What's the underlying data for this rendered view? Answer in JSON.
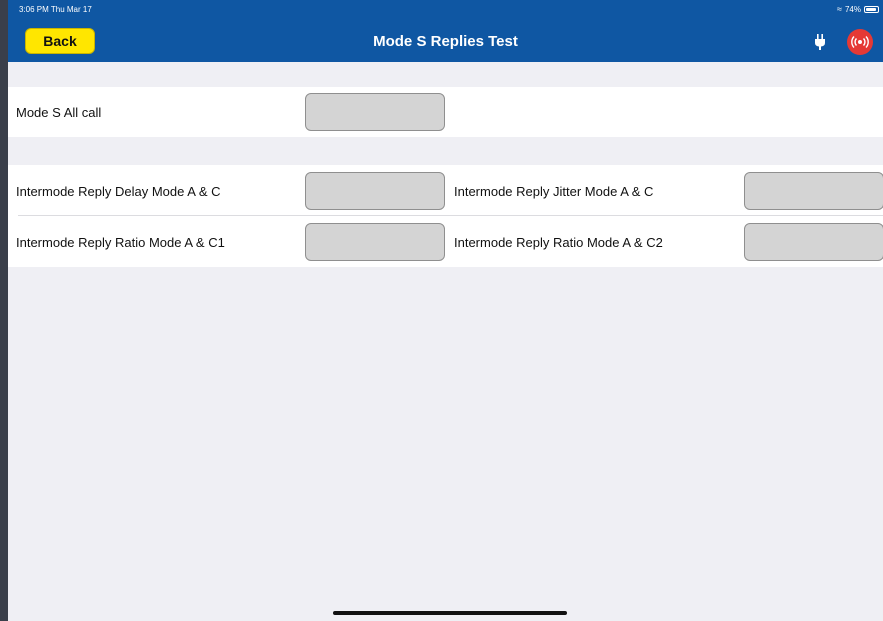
{
  "status_bar": {
    "time": "3:06 PM  Thu Mar 17",
    "battery": "74%"
  },
  "navbar": {
    "back_label": "Back",
    "title": "Mode S Replies Test",
    "brand_color": "#0f57a3",
    "back_color": "#ffe600",
    "alert_color": "#e53935"
  },
  "section1": {
    "label": "Mode S All call",
    "value": ""
  },
  "section2": {
    "rows": [
      {
        "left_label": "Intermode Reply Delay Mode A & C",
        "left_value": "",
        "right_label": "Intermode Reply Jitter Mode A & C",
        "right_value": ""
      },
      {
        "left_label": "Intermode Reply Ratio Mode A & C1",
        "left_value": "",
        "right_label": "Intermode Reply Ratio Mode A & C2",
        "right_value": ""
      }
    ]
  },
  "icons": [
    "wifi-icon",
    "battery-icon",
    "plug-icon",
    "broadcast-icon"
  ]
}
